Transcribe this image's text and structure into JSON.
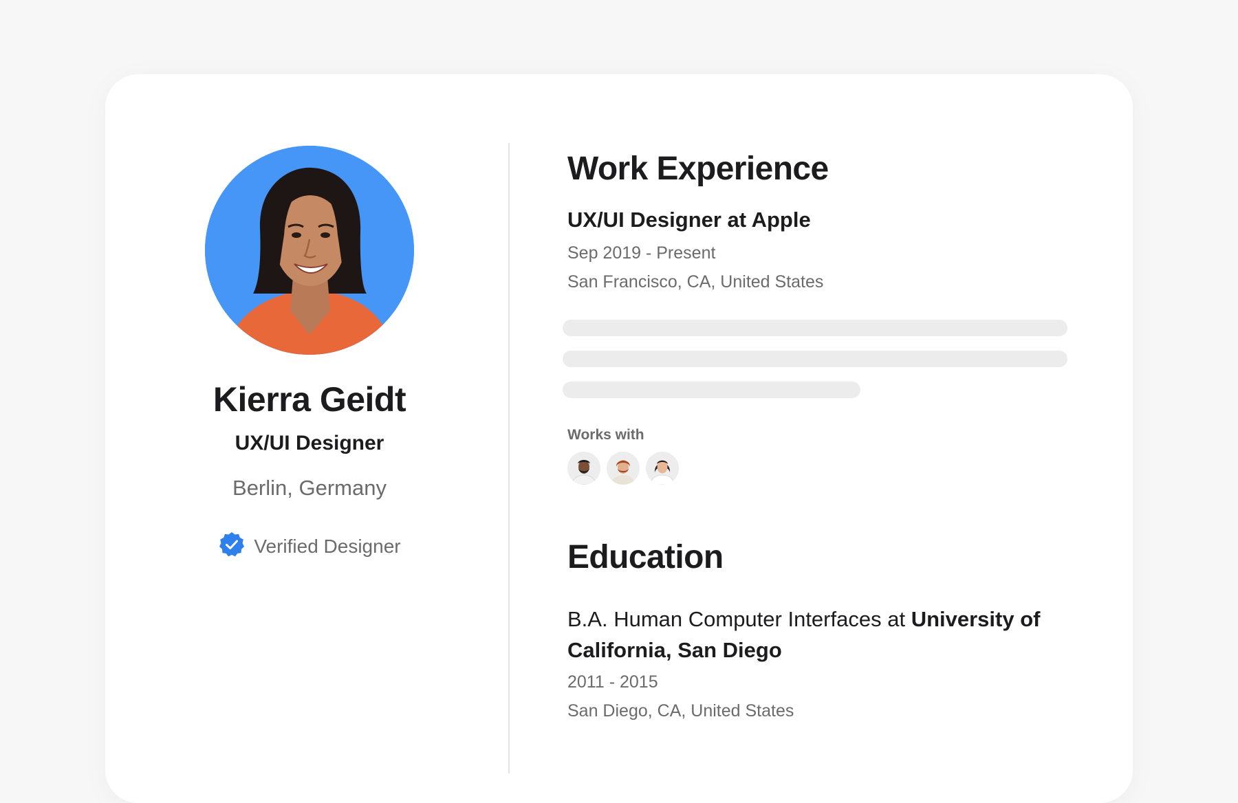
{
  "profile": {
    "name": "Kierra Geidt",
    "role": "UX/UI Designer",
    "location": "Berlin, Germany",
    "verified_label": "Verified Designer",
    "avatar_icon": "profile-photo",
    "verified_icon": "verified-badge-icon"
  },
  "work": {
    "title": "Work Experience",
    "job_title": "UX/UI Designer at Apple",
    "dates": "Sep 2019 - Present",
    "location": "San Francisco, CA, United States",
    "works_with_label": "Works with",
    "coworkers": [
      "coworker-avatar-1",
      "coworker-avatar-2",
      "coworker-avatar-3"
    ]
  },
  "education": {
    "title": "Education",
    "degree": "B.A. Human Computer Interfaces at",
    "school": "University of California, San Diego",
    "dates": "2011 - 2015",
    "location": "San Diego, CA, United States"
  },
  "colors": {
    "accent": "#4596f7",
    "verified": "#2f80ed",
    "text_primary": "#1c1c1e",
    "text_secondary": "#6b6b6b",
    "skeleton": "#ececec",
    "background": "#f7f7f7"
  }
}
